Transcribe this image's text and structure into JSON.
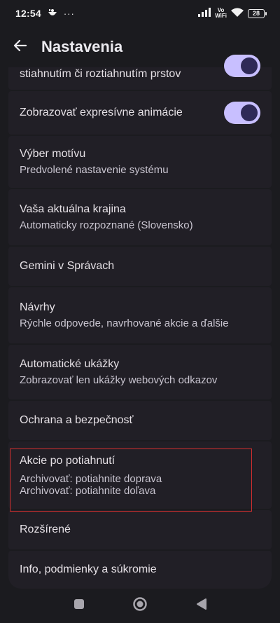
{
  "status_bar": {
    "time": "12:54",
    "more": "···",
    "vowifi_top": "Vo",
    "vowifi_bottom": "WiFi",
    "battery": "28"
  },
  "app_bar": {
    "title": "Nastavenia"
  },
  "settings": [
    {
      "title": "stiahnutím či roztiahnutím prstov",
      "toggle_on": true
    },
    {
      "title": "Zobrazovať expresívne animácie",
      "toggle_on": true
    },
    {
      "title": "Výber motívu",
      "subtitle": "Predvolené nastavenie systému"
    },
    {
      "title": "Vaša aktuálna krajina",
      "subtitle": "Automaticky rozpoznané (Slovensko)"
    },
    {
      "title": "Gemini v Správach"
    },
    {
      "title": "Návrhy",
      "subtitle": "Rýchle odpovede, navrhované akcie a ďalšie"
    },
    {
      "title": "Automatické ukážky",
      "subtitle": "Zobrazovať len ukážky webových odkazov"
    },
    {
      "title": "Ochrana a bezpečnosť"
    },
    {
      "title": "Akcie po potiahnutí",
      "subtitle": "Archivovať: potiahnite doprava",
      "subtitle2": "Archivovať: potiahnite doľava"
    },
    {
      "title": "Rozšírené"
    },
    {
      "title": "Info, podmienky a súkromie"
    }
  ],
  "colors": {
    "accent": "#c8bfff",
    "highlight": "#d32f2f",
    "card": "#211f26",
    "background": "#1b1b1f"
  },
  "icons": {
    "back": "arrow-left-icon",
    "nav_recents": "square-icon",
    "nav_home": "circle-icon",
    "nav_back": "triangle-icon"
  }
}
